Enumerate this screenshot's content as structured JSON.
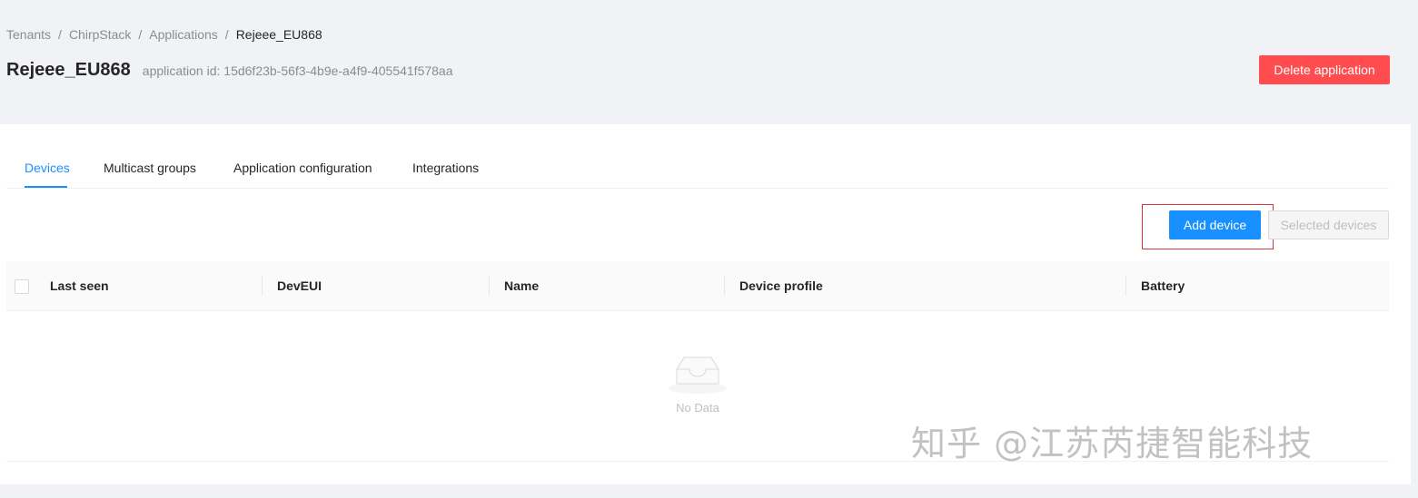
{
  "breadcrumb": {
    "items": [
      "Tenants",
      "ChirpStack",
      "Applications",
      "Rejeee_EU868"
    ],
    "separator": "/"
  },
  "header": {
    "title": "Rejeee_EU868",
    "app_id": "application id: 15d6f23b-56f3-4b9e-a4f9-405541f578aa",
    "delete_label": "Delete application"
  },
  "tabs": [
    {
      "label": "Devices",
      "active": true
    },
    {
      "label": "Multicast groups",
      "active": false
    },
    {
      "label": "Application configuration",
      "active": false
    },
    {
      "label": "Integrations",
      "active": false
    }
  ],
  "toolbar": {
    "add_label": "Add device",
    "selected_label": "Selected devices"
  },
  "table": {
    "columns": [
      "Last seen",
      "DevEUI",
      "Name",
      "Device profile",
      "Battery"
    ],
    "rows": [],
    "empty_text": "No Data"
  },
  "watermark": "知乎 @江苏芮捷智能科技",
  "colors": {
    "primary": "#1890ff",
    "danger": "#ff4d4f",
    "background": "#f0f2f5"
  }
}
